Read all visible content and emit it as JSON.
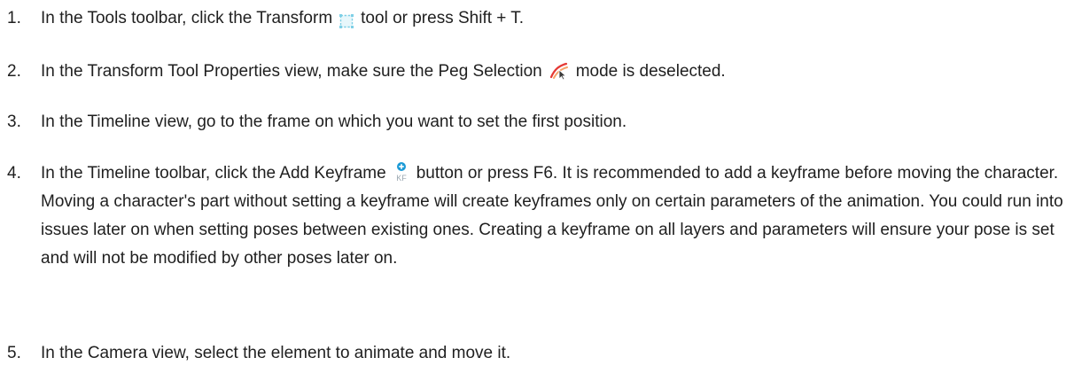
{
  "steps": [
    {
      "number": "1.",
      "text_before": "In the Tools toolbar, click the Transform",
      "icon": "transform-tool-icon",
      "text_after": "tool or press Shift + T."
    },
    {
      "number": "2.",
      "text_before": "In the Transform Tool Properties view, make sure the Peg Selection",
      "icon": "peg-selection-icon",
      "text_after": "mode is deselected."
    },
    {
      "number": "3.",
      "text": "In the Timeline view, go to the frame on which you want to set the first position."
    },
    {
      "number": "4.",
      "text_before": "In the Timeline toolbar, click the Add Keyframe",
      "icon": "add-keyframe-icon",
      "text_after": "button or press F6. It is recommended to add a keyframe before moving the character. Moving a character's part without setting a keyframe will create keyframes only on certain parameters of the animation. You could run into issues later on when setting poses between existing ones. Creating a keyframe on all layers and parameters will ensure your pose is set and will not be modified by other poses later on."
    },
    {
      "number": "5.",
      "text": "In the Camera view, select the element to animate and move it."
    }
  ],
  "icon_colors": {
    "transform": "#7fd0e6",
    "peg_red": "#e53935",
    "peg_orange": "#f6a36a",
    "keyframe_blue": "#1c9ad6",
    "keyframe_text": "#9aa7b0"
  }
}
